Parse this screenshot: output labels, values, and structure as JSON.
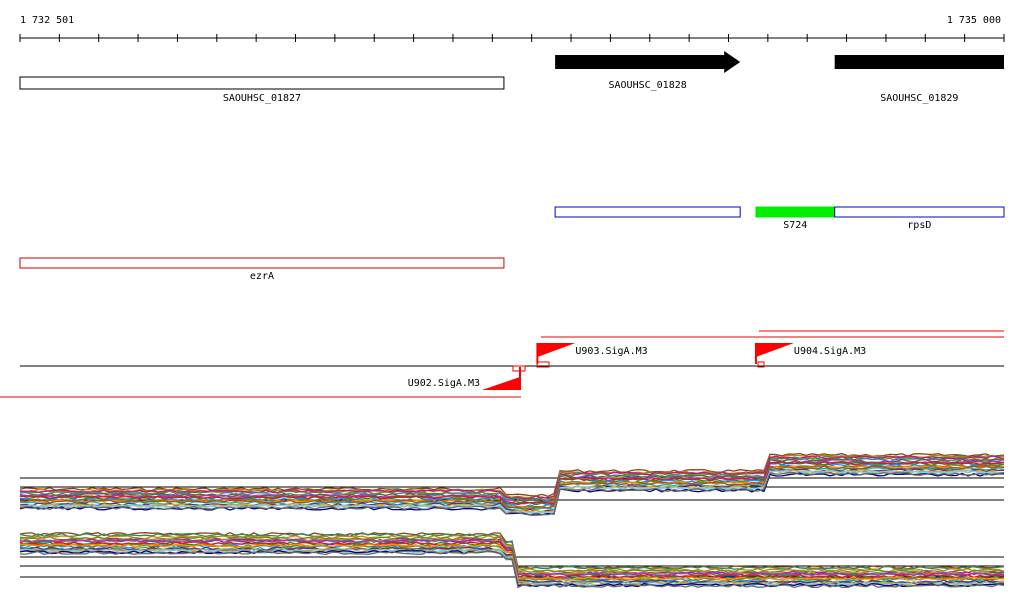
{
  "ruler": {
    "start_label": "1 732 501",
    "end_label": "1 735 000",
    "start": 1732501,
    "end": 1735000
  },
  "genes_strand_plus": [
    {
      "name": "SAOUHSC_01828",
      "start": 1733860,
      "end": 1734330,
      "style": "filled-arrow"
    },
    {
      "name": "SAOUHSC_01829",
      "start": 1734570,
      "end": 1735000,
      "style": "filled-bar"
    }
  ],
  "genes_strand_minus": [
    {
      "name": "SAOUHSC_01827",
      "start": 1732501,
      "end": 1733730,
      "style": "open-box"
    }
  ],
  "features_plus": [
    {
      "name": "",
      "start": 1733860,
      "end": 1734330,
      "color": "#0000cc",
      "style": "open-box"
    },
    {
      "name": "S724",
      "start": 1734370,
      "end": 1734570,
      "color": "#00ee00",
      "style": "filled-box"
    },
    {
      "name": "rpsD",
      "start": 1734570,
      "end": 1735000,
      "color": "#0000cc",
      "style": "open-box"
    }
  ],
  "features_minus": [
    {
      "name": "ezrA",
      "start": 1732501,
      "end": 1733730,
      "color": "#cc0000",
      "style": "open-box"
    }
  ],
  "promoters": [
    {
      "name": "U902.SigA.M3",
      "strand": "-",
      "pos": 1733825
    },
    {
      "name": "U903.SigA.M3",
      "strand": "+",
      "pos": 1733815
    },
    {
      "name": "U904.SigA.M3",
      "strand": "+",
      "pos": 1734370
    }
  ],
  "colors": {
    "promoter": "#ff0000",
    "terminator_line": "#ee0000",
    "gene_outline": "#000000"
  }
}
